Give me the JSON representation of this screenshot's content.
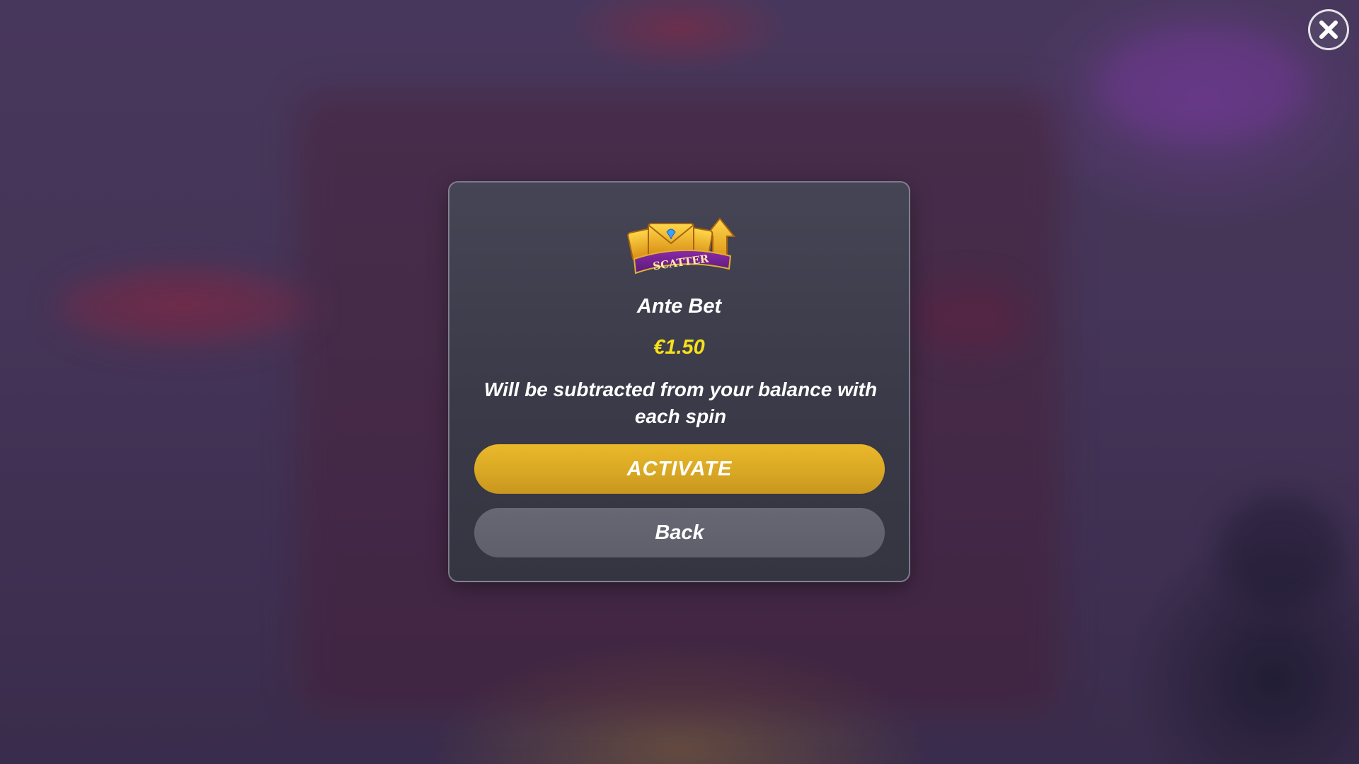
{
  "dialog": {
    "title": "Ante Bet",
    "amount": "€1.50",
    "message": "Will be subtracted from your balance with each spin",
    "activate_label": "ACTIVATE",
    "back_label": "Back",
    "artwork_text": "SCATTER"
  },
  "icons": {
    "close": "close-icon",
    "artwork": "scatter-icon"
  },
  "colors": {
    "amount": "#f6e11a",
    "activate_button": "#e0ae26",
    "back_button": "#63636f",
    "modal_background": "#3e3e4c"
  }
}
